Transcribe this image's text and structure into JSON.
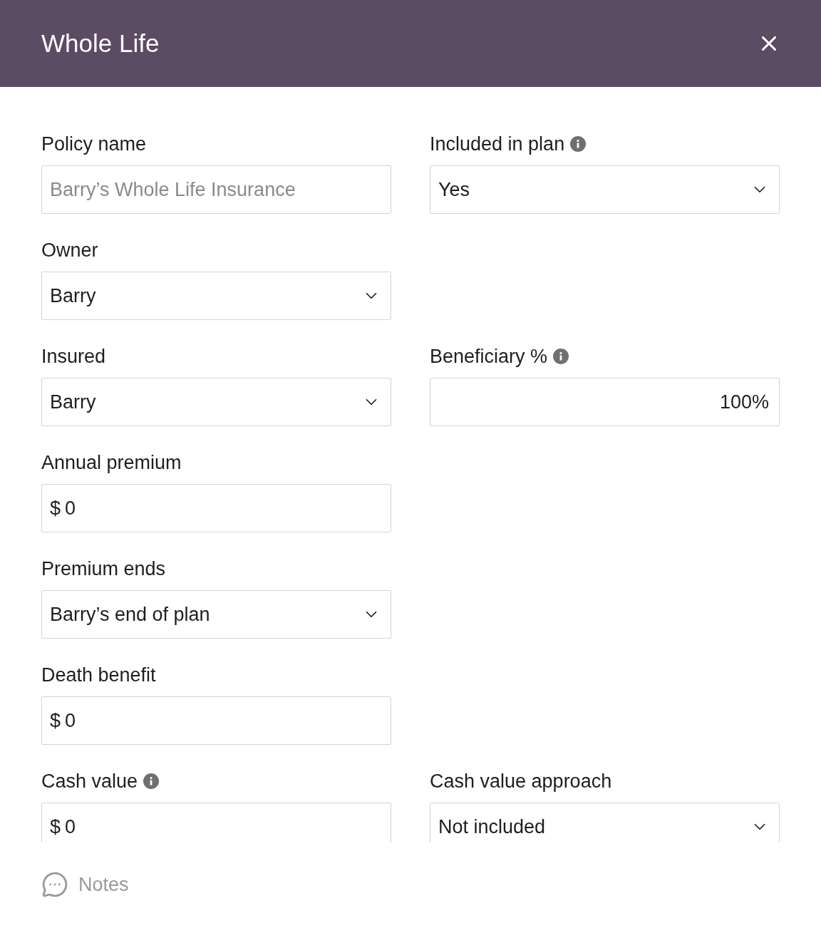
{
  "header": {
    "title": "Whole Life"
  },
  "rows": [
    {
      "left": {
        "label": "Policy name",
        "kind": "text",
        "placeholder": "Barry’s Whole Life Insurance"
      },
      "right": {
        "label": "Included in plan",
        "info": true,
        "kind": "select",
        "value": "Yes"
      }
    },
    {
      "left": {
        "label": "Owner",
        "kind": "select",
        "value": "Barry"
      }
    },
    {
      "left": {
        "label": "Insured",
        "kind": "select",
        "value": "Barry"
      },
      "right": {
        "label": "Beneficiary %",
        "info": true,
        "kind": "percent",
        "value": "100%"
      }
    },
    {
      "left": {
        "label": "Annual premium",
        "kind": "currency",
        "prefix": "$",
        "value": "0"
      }
    },
    {
      "left": {
        "label": "Premium ends",
        "kind": "select",
        "value": "Barry’s end of plan"
      }
    },
    {
      "left": {
        "label": "Death benefit",
        "kind": "currency",
        "prefix": "$",
        "value": "0"
      }
    },
    {
      "left": {
        "label": "Cash value",
        "info": true,
        "kind": "currency",
        "prefix": "$",
        "value": "0"
      },
      "right": {
        "label": "Cash value approach",
        "kind": "select",
        "value": "Not included"
      }
    }
  ],
  "footer": {
    "notes": "Notes"
  }
}
